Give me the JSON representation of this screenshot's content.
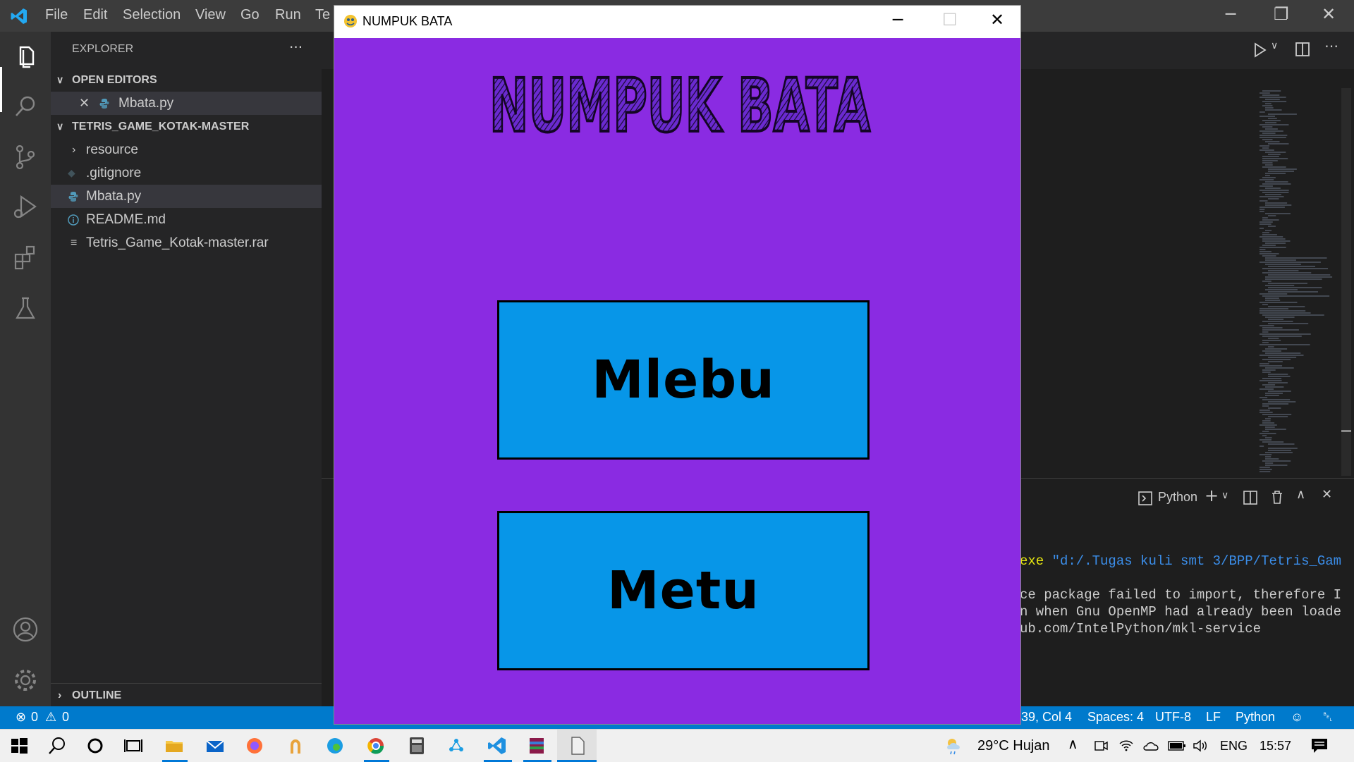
{
  "vscode": {
    "menu": [
      "File",
      "Edit",
      "Selection",
      "View",
      "Go",
      "Run",
      "Te"
    ],
    "sidebar": {
      "header": "EXPLORER",
      "more": "···",
      "open_editors_label": "OPEN EDITORS",
      "open_editor_file": "Mbata.py",
      "folder_label": "TETRIS_GAME_KOTAK-MASTER",
      "items": [
        {
          "label": "resource",
          "icon": "chevron-right-icon"
        },
        {
          "label": ".gitignore",
          "icon": "git-icon"
        },
        {
          "label": "Mbata.py",
          "icon": "python-icon"
        },
        {
          "label": "README.md",
          "icon": "info-icon"
        },
        {
          "label": "Tetris_Game_Kotak-master.rar",
          "icon": "file-lines-icon"
        }
      ],
      "outline_label": "OUTLINE"
    },
    "panel": {
      "shell": "Python",
      "lines": [
        {
          "prefix": "exe",
          "text": " \"d:/.Tugas kuli smt 3/BPP/Tetris_Gam"
        },
        {
          "prefix": "",
          "text": "ce package failed to import, therefore I"
        },
        {
          "prefix": "",
          "text": "n when Gnu OpenMP had already been loade"
        },
        {
          "prefix": "",
          "text": "ub.com/IntelPython/mkl-service"
        }
      ]
    },
    "statusbar": {
      "errors": "0",
      "warnings": "0",
      "position": "39, Col 4",
      "spaces": "Spaces: 4",
      "encoding": "UTF-8",
      "eol": "LF",
      "language": "Python"
    }
  },
  "game": {
    "window_title": "NUMPUK BATA",
    "logo_text": "NUMPUK BATA",
    "buttons": {
      "enter": "Mlebu",
      "exit": "Metu"
    },
    "colors": {
      "background": "#8a2be2",
      "button": "#0796e8"
    }
  },
  "taskbar": {
    "weather": "29°C  Hujan",
    "language": "ENG",
    "time": "15:57"
  }
}
